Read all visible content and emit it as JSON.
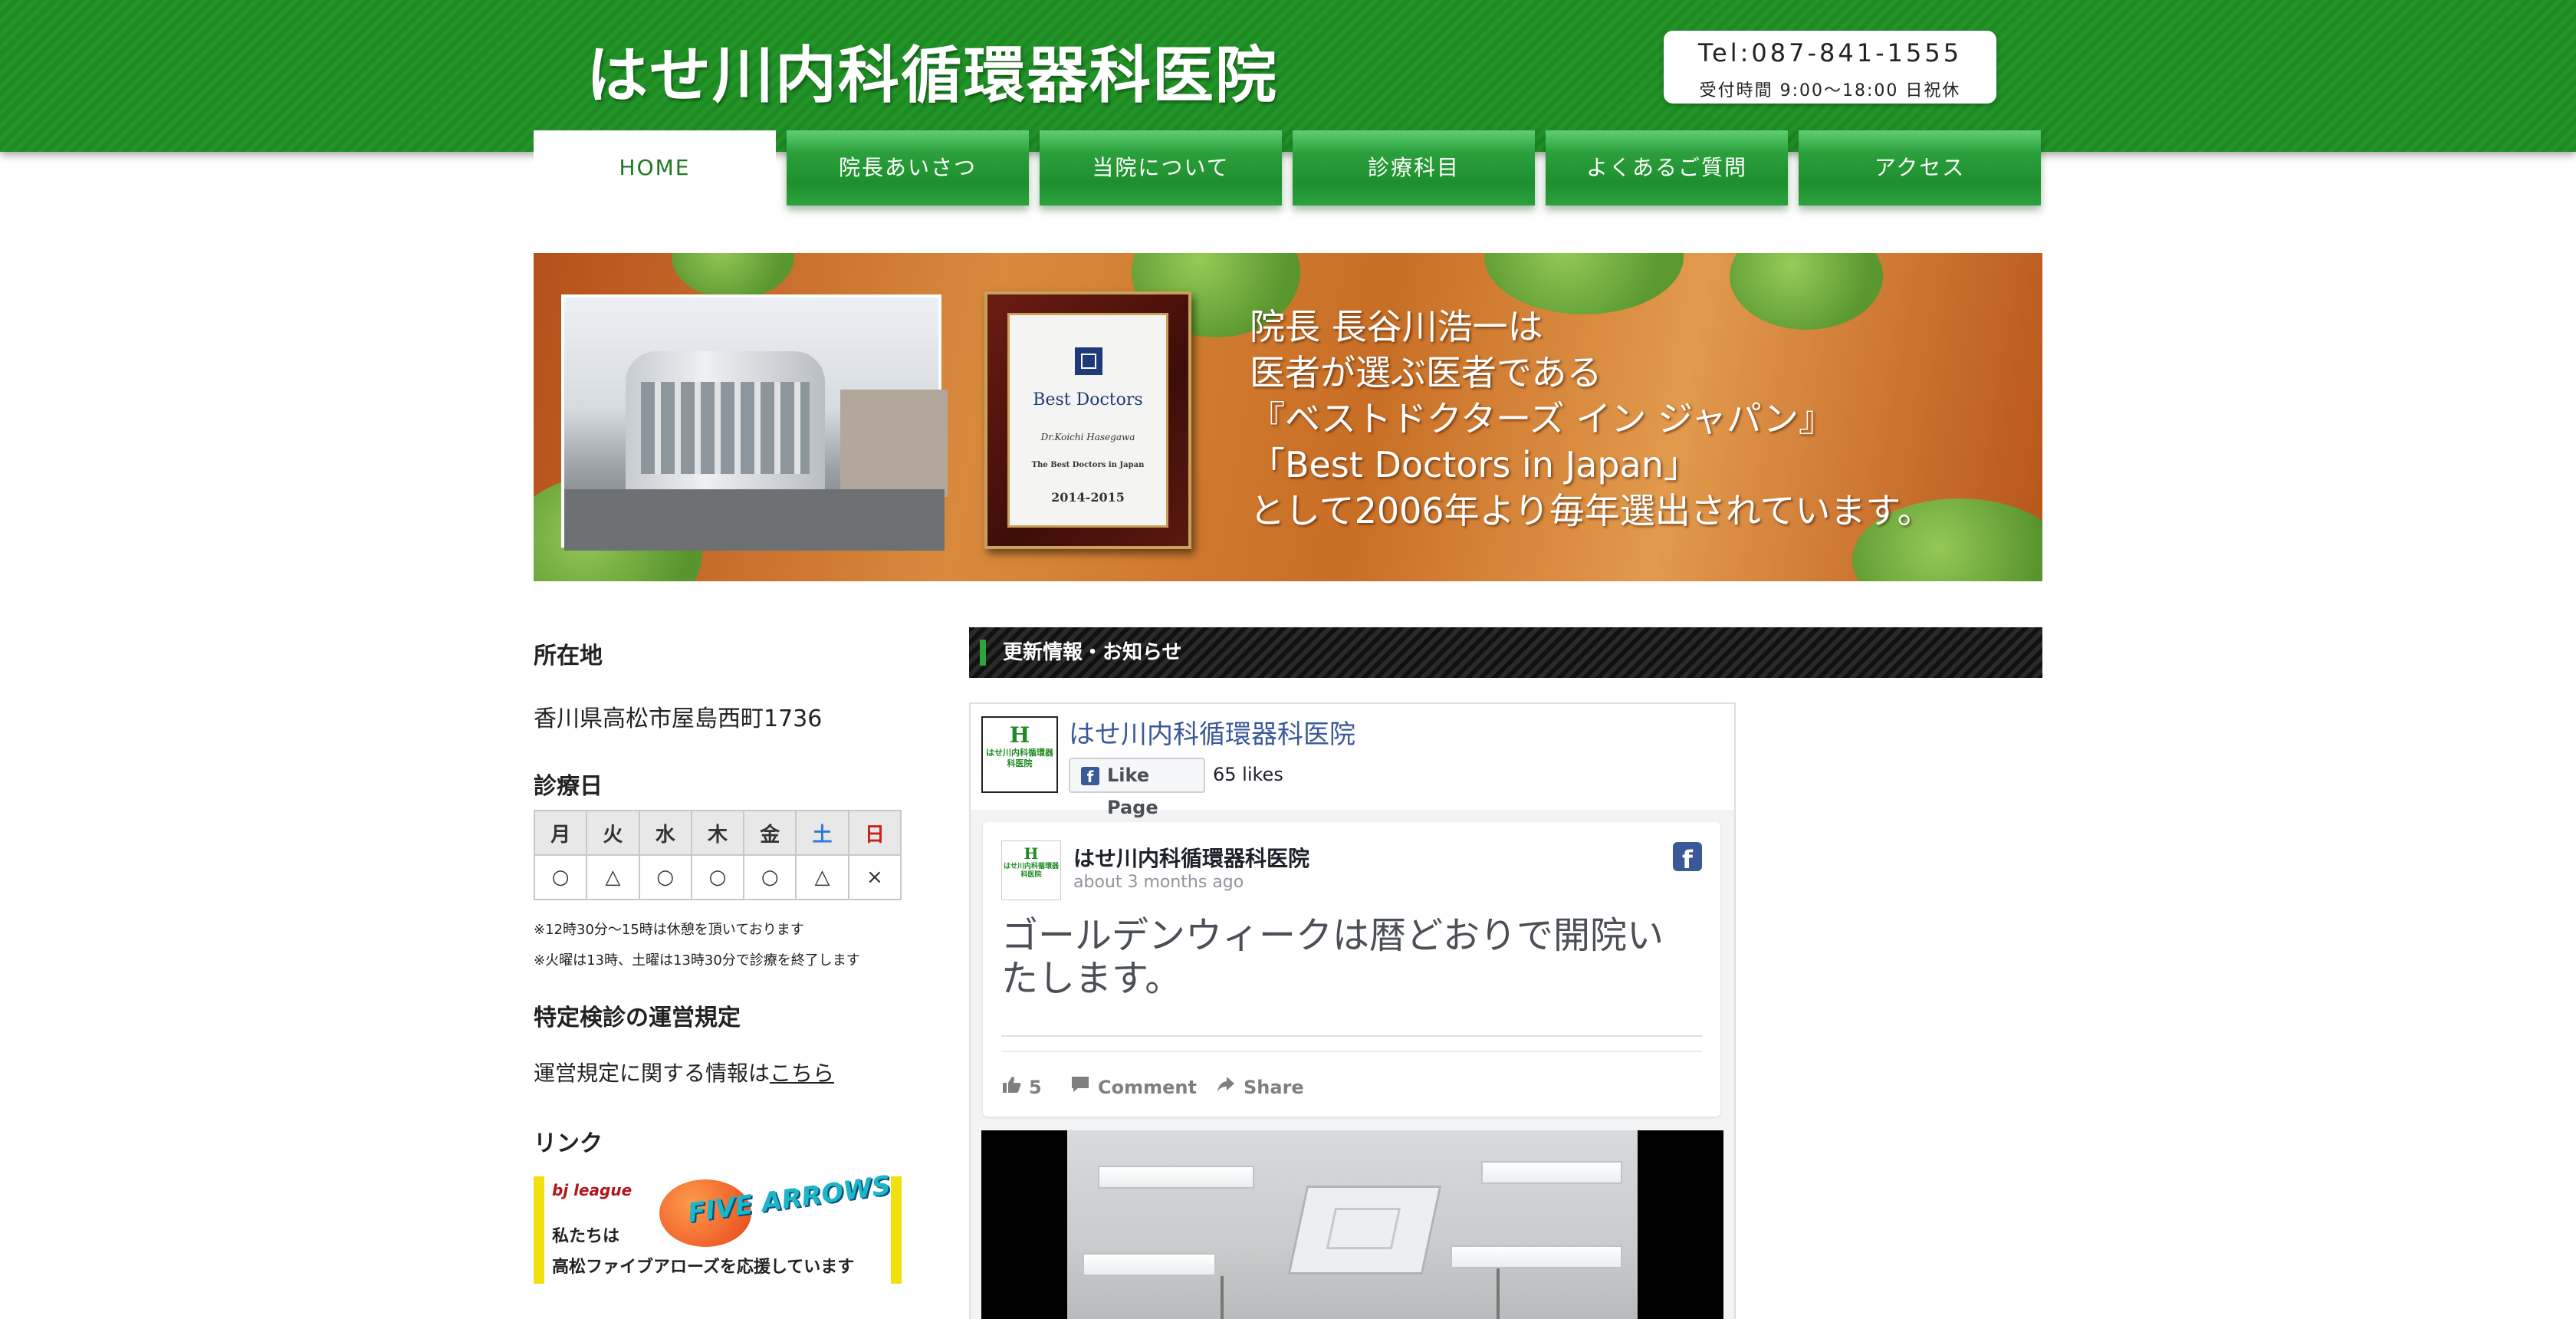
{
  "header": {
    "site_title": "はせ川内科循環器科医院",
    "tel": "Tel:087-841-1555",
    "hours": "受付時間 9:00〜18:00 日祝休"
  },
  "nav": {
    "items": [
      {
        "label": "HOME"
      },
      {
        "label": "院長あいさつ"
      },
      {
        "label": "当院について"
      },
      {
        "label": "診療科目"
      },
      {
        "label": "よくあるご質問"
      },
      {
        "label": "アクセス"
      }
    ],
    "active_index": 0,
    "accent_color": "#1d8a22"
  },
  "banner": {
    "lines": [
      "院長 長谷川浩一は",
      "医者が選ぶ医者である",
      "『ベストドクターズ イン ジャパン』",
      "「Best Doctors in Japan」",
      "として2006年より毎年選出されています。"
    ],
    "plaque": {
      "title": "Best Doctors",
      "name": "Dr.Koichi Hasegawa",
      "subtitle": "The Best Doctors in Japan",
      "years": "2014-2015"
    }
  },
  "sidebar": {
    "location_heading": "所在地",
    "address": "香川県高松市屋島西町1736",
    "schedule_heading": "診療日",
    "days": [
      "月",
      "火",
      "水",
      "木",
      "金",
      "土",
      "日"
    ],
    "marks": [
      "○",
      "△",
      "○",
      "○",
      "○",
      "△",
      "×"
    ],
    "note1": "※12時30分〜15時は休憩を頂いております",
    "note2": "※火曜は13時、土曜は13時30分で診療を終了します",
    "rules_heading": "特定検診の運営規定",
    "rules_text": "運営規定に関する情報は",
    "rules_link": "こちら",
    "links_heading": "リンク",
    "arrows_banner": {
      "league_mark": "bj league",
      "team_logo": "FIVE ARROWS",
      "line1": "私たちは",
      "line2": "高松ファイブアローズを応援しています"
    }
  },
  "news": {
    "heading": "更新情報・お知らせ"
  },
  "facebook": {
    "avatar_letter": "H",
    "avatar_text": "はせ川内科循環器科医院",
    "page_name": "はせ川内科循環器科医院",
    "like_label": "Like Page",
    "likes": "65 likes",
    "post": {
      "author": "はせ川内科循環器科医院",
      "time": "about 3 months ago",
      "text": "ゴールデンウィークは暦どおりで開院いたします。",
      "like_count": "5",
      "comment_label": "Comment",
      "share_label": "Share"
    },
    "brand_color": "#3b5998"
  }
}
